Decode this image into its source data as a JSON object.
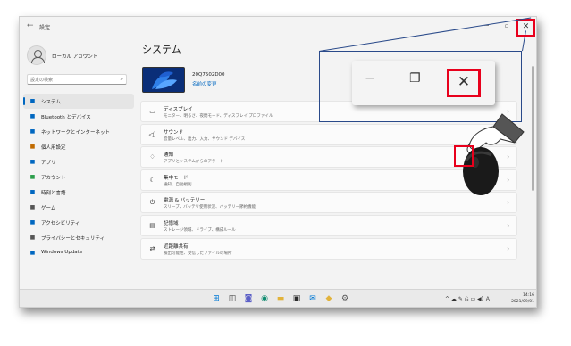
{
  "window": {
    "title": "設定",
    "back_glyph": "←",
    "minimize_glyph": "−",
    "maximize_glyph": "▫",
    "close_glyph": "✕"
  },
  "sidebar": {
    "user_name": "ローカル アカウント",
    "search_placeholder": "設定の検索",
    "items": [
      {
        "label": "システム",
        "icon": "display-icon",
        "color": "#0067c0",
        "active": true
      },
      {
        "label": "Bluetooth とデバイス",
        "icon": "bluetooth-icon",
        "color": "#0067c0",
        "active": false
      },
      {
        "label": "ネットワークとインターネット",
        "icon": "network-icon",
        "color": "#0067c0",
        "active": false
      },
      {
        "label": "個人用設定",
        "icon": "brush-icon",
        "color": "#c06a00",
        "active": false
      },
      {
        "label": "アプリ",
        "icon": "apps-icon",
        "color": "#0067c0",
        "active": false
      },
      {
        "label": "アカウント",
        "icon": "person-icon",
        "color": "#2a9d4a",
        "active": false
      },
      {
        "label": "時刻と言語",
        "icon": "globe-clock-icon",
        "color": "#0067c0",
        "active": false
      },
      {
        "label": "ゲーム",
        "icon": "gamepad-icon",
        "color": "#555555",
        "active": false
      },
      {
        "label": "アクセシビリティ",
        "icon": "accessibility-icon",
        "color": "#0067c0",
        "active": false
      },
      {
        "label": "プライバシーとセキュリティ",
        "icon": "shield-icon",
        "color": "#555555",
        "active": false
      },
      {
        "label": "Windows Update",
        "icon": "update-icon",
        "color": "#0067c0",
        "active": false
      }
    ]
  },
  "main": {
    "page_title": "システム",
    "device_name": "20Q7502D00",
    "rename_label": "名前の変更",
    "cards": [
      {
        "title": "ディスプレイ",
        "subtitle": "モニター、明るさ、夜間モード、ディスプレイ プロファイル",
        "icon": "monitor-icon"
      },
      {
        "title": "サウンド",
        "subtitle": "音量レベル、出力、入力、サウンド デバイス",
        "icon": "speaker-icon"
      },
      {
        "title": "通知",
        "subtitle": "アプリとシステムからのアラート",
        "icon": "bell-icon"
      },
      {
        "title": "集中モード",
        "subtitle": "通知、自動規則",
        "icon": "moon-icon"
      },
      {
        "title": "電源 & バッテリー",
        "subtitle": "スリープ、バッテリ使用状況、バッテリー節約機能",
        "icon": "power-icon"
      },
      {
        "title": "記憶域",
        "subtitle": "ストレージ領域、ドライブ、構成ルール",
        "icon": "storage-icon"
      },
      {
        "title": "近距離共有",
        "subtitle": "検出可能性、受信したファイルの場所",
        "icon": "share-icon"
      }
    ],
    "chevron": "›"
  },
  "callout": {
    "minimize_glyph": "−",
    "maximize_glyph": "❐",
    "close_glyph": "✕",
    "highlight_color": "#e8001c"
  },
  "taskbar": {
    "apps": [
      {
        "name": "start-icon",
        "glyph": "⊞",
        "color": "#0078d4"
      },
      {
        "name": "task-view-icon",
        "glyph": "◫",
        "color": "#333333"
      },
      {
        "name": "chat-icon",
        "glyph": "◙",
        "color": "#5b5fc7"
      },
      {
        "name": "edge-icon",
        "glyph": "◉",
        "color": "#0c8a6e"
      },
      {
        "name": "explorer-icon",
        "glyph": "▬",
        "color": "#e2b33b"
      },
      {
        "name": "store-icon",
        "glyph": "▣",
        "color": "#2b2b2b"
      },
      {
        "name": "mail-icon",
        "glyph": "✉",
        "color": "#0078d4"
      },
      {
        "name": "office-icon",
        "glyph": "◆",
        "color": "#e2b33b"
      },
      {
        "name": "settings-icon",
        "glyph": "⚙",
        "color": "#555555"
      }
    ],
    "tray": "^ ☁ ✎ ⎌ ▭ ◀) Ａ",
    "time": "14:16",
    "date": "2021/09/01"
  }
}
